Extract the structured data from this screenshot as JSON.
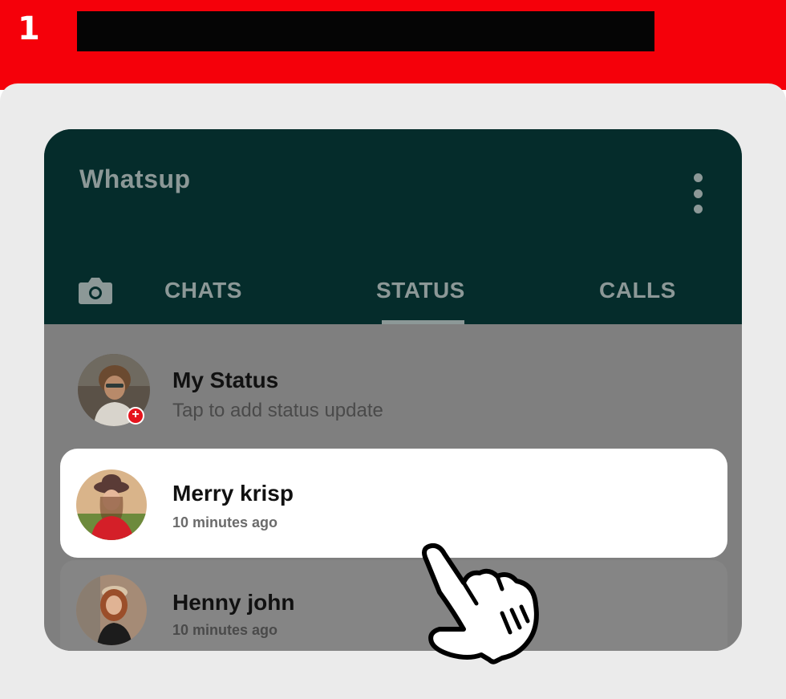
{
  "banner": {
    "step_number": "1"
  },
  "app": {
    "title": "Whatsup",
    "menu_icon": "more-vertical-icon"
  },
  "tabs": {
    "camera_icon": "camera-icon",
    "items": [
      {
        "label": "CHATS"
      },
      {
        "label": "STATUS"
      },
      {
        "label": "CALLS"
      }
    ]
  },
  "status_list": {
    "my_status": {
      "name": "My Status",
      "subtitle": "Tap to add status update",
      "badge": "+"
    },
    "items": [
      {
        "name": "Merry krisp",
        "time": "10 minutes ago"
      },
      {
        "name": "Henny john",
        "time": "10 minutes ago"
      }
    ]
  },
  "colors": {
    "banner": "#f5000a",
    "header": "#052c2b",
    "overlay": "#7f7f7f",
    "badge": "#e5131c"
  },
  "pointer_icon": "hand-pointer-icon"
}
